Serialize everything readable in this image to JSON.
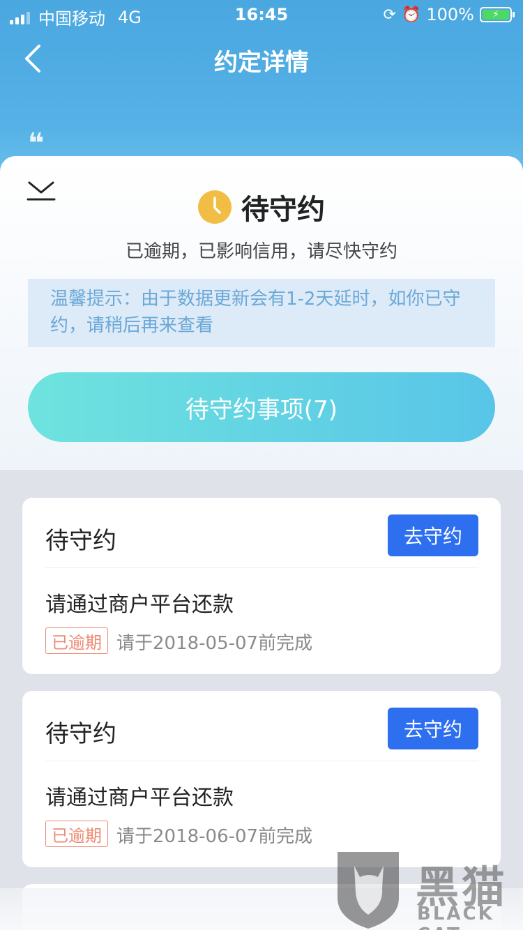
{
  "status_bar": {
    "carrier": "中国移动",
    "network": "4G",
    "time": "16:45",
    "battery": "100%"
  },
  "nav": {
    "title": "约定详情"
  },
  "status": {
    "title": "待守约",
    "subtitle": "已逾期，已影响信用，请尽快守约",
    "tip": "温馨提示：由于数据更新会有1-2天延时，如你已守约，请稍后再来查看",
    "pending_button": "待守约事项(7)"
  },
  "cards": [
    {
      "title": "待守约",
      "action": "去守约",
      "description": "请通过商户平台还款",
      "badge": "已逾期",
      "deadline": "请于2018-05-07前完成"
    },
    {
      "title": "待守约",
      "action": "去守约",
      "description": "请通过商户平台还款",
      "badge": "已逾期",
      "deadline": "请于2018-06-07前完成"
    }
  ],
  "watermark": {
    "text": "黑猫",
    "sub": "BLACK CAT"
  },
  "colors": {
    "accent_blue": "#2e6ff0",
    "overdue_red": "#ef8a74",
    "clock_yellow": "#f2bd45",
    "tip_text": "#6ca8d8"
  }
}
